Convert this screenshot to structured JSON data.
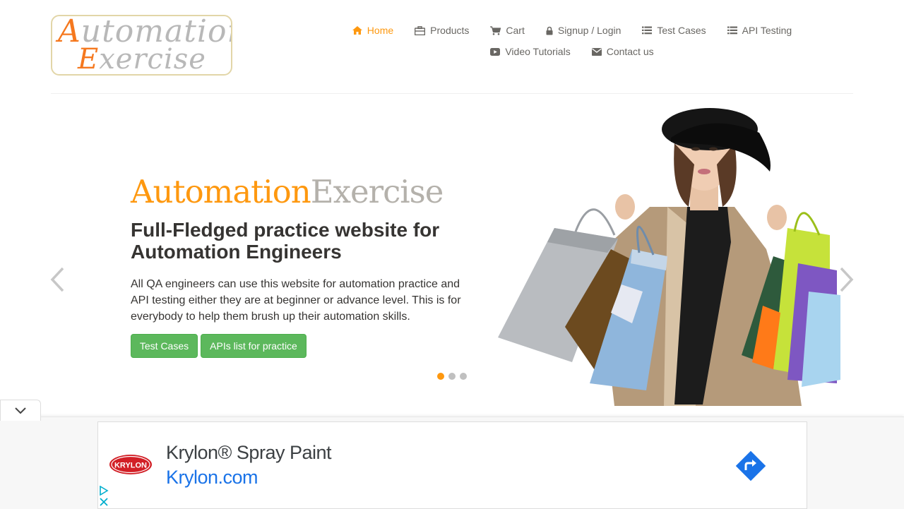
{
  "logo": {
    "line1_cap": "A",
    "line1_rest": "utomation",
    "line2_cap": "E",
    "line2_rest": "xercise"
  },
  "nav": {
    "items": [
      {
        "label": "Home",
        "icon": "home-icon",
        "active": true
      },
      {
        "label": "Products",
        "icon": "briefcase-icon"
      },
      {
        "label": "Cart",
        "icon": "cart-icon"
      },
      {
        "label": "Signup / Login",
        "icon": "lock-icon"
      },
      {
        "label": "Test Cases",
        "icon": "list-icon"
      },
      {
        "label": "API Testing",
        "icon": "list-icon"
      },
      {
        "label": "Video Tutorials",
        "icon": "youtube-icon"
      },
      {
        "label": "Contact us",
        "icon": "envelope-icon"
      }
    ]
  },
  "slider": {
    "brand_part1": "Automation",
    "brand_part2": "Exercise",
    "headline": "Full-Fledged practice website for Automation Engineers",
    "description": "All QA engineers can use this website for automation practice and API testing either they are at beginner or advance level. This is for everybody to help them brush up their automation skills.",
    "buttons": {
      "test_cases": "Test Cases",
      "apis_list": "APIs list for practice"
    },
    "active_slide": 1,
    "slide_count": 3
  },
  "ad": {
    "brand_logo_text": "KRYLON",
    "title": "Krylon® Spray Paint",
    "url": "Krylon.com"
  },
  "colors": {
    "accent": "#fe980f",
    "button": "#5cb85c",
    "brand_gray": "#b4b1ab",
    "ad_link": "#1a73e8"
  }
}
